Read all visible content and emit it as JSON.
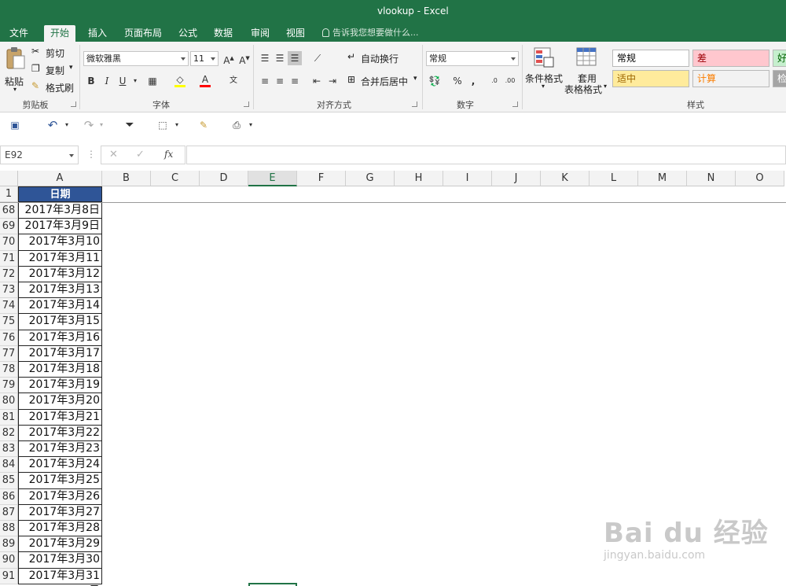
{
  "window": {
    "title": "vlookup - Excel"
  },
  "tabs": [
    "文件",
    "开始",
    "插入",
    "页面布局",
    "公式",
    "数据",
    "审阅",
    "视图"
  ],
  "tell_me": "告诉我您想要做什么...",
  "ribbon": {
    "clipboard": {
      "label": "剪贴板",
      "paste": "粘贴",
      "cut": "剪切",
      "copy": "复制",
      "format_painter": "格式刷"
    },
    "font": {
      "label": "字体",
      "font_name": "微软雅黑",
      "font_size": "11",
      "bold": "B",
      "italic": "I",
      "underline": "U"
    },
    "alignment": {
      "label": "对齐方式",
      "wrap_text": "自动换行",
      "merge_center": "合并后居中"
    },
    "number": {
      "label": "数字",
      "format": "常规",
      "percent": "%",
      "comma": ","
    },
    "styles": {
      "label": "样式",
      "conditional_formatting": "条件格式",
      "format_as_table_1": "套用",
      "format_as_table_2": "表格格式",
      "cells": [
        {
          "text": "常规",
          "bg": "#ffffff",
          "fg": "#000000"
        },
        {
          "text": "差",
          "bg": "#ffc7ce",
          "fg": "#9c0006"
        },
        {
          "text": "好",
          "bg": "#c6efce",
          "fg": "#006100"
        },
        {
          "text": "适中",
          "bg": "#ffeb9c",
          "fg": "#9c6500"
        },
        {
          "text": "计算",
          "bg": "#f2f2f2",
          "fg": "#fa7d00"
        },
        {
          "text": "检",
          "bg": "#a5a5a5",
          "fg": "#ffffff"
        }
      ]
    }
  },
  "formula_bar": {
    "name_box": "E92",
    "fx": "fx",
    "cancel": "✕",
    "enter": "✓",
    "content": ""
  },
  "grid": {
    "columns": [
      "A",
      "B",
      "C",
      "D",
      "E",
      "F",
      "G",
      "H",
      "I",
      "J",
      "K",
      "L",
      "M",
      "N",
      "O"
    ],
    "selected_column": "E",
    "header_row": {
      "row": "1",
      "value": "日期"
    },
    "rows": [
      {
        "row": "68",
        "value": "2017年3月8日"
      },
      {
        "row": "69",
        "value": "2017年3月9日"
      },
      {
        "row": "70",
        "value": "2017年3月10日"
      },
      {
        "row": "71",
        "value": "2017年3月11日"
      },
      {
        "row": "72",
        "value": "2017年3月12日"
      },
      {
        "row": "73",
        "value": "2017年3月13日"
      },
      {
        "row": "74",
        "value": "2017年3月14日"
      },
      {
        "row": "75",
        "value": "2017年3月15日"
      },
      {
        "row": "76",
        "value": "2017年3月16日"
      },
      {
        "row": "77",
        "value": "2017年3月17日"
      },
      {
        "row": "78",
        "value": "2017年3月18日"
      },
      {
        "row": "79",
        "value": "2017年3月19日"
      },
      {
        "row": "80",
        "value": "2017年3月20日"
      },
      {
        "row": "81",
        "value": "2017年3月21日"
      },
      {
        "row": "82",
        "value": "2017年3月22日"
      },
      {
        "row": "83",
        "value": "2017年3月23日"
      },
      {
        "row": "84",
        "value": "2017年3月24日"
      },
      {
        "row": "85",
        "value": "2017年3月25日"
      },
      {
        "row": "86",
        "value": "2017年3月26日"
      },
      {
        "row": "87",
        "value": "2017年3月27日"
      },
      {
        "row": "88",
        "value": "2017年3月28日"
      },
      {
        "row": "89",
        "value": "2017年3月29日"
      },
      {
        "row": "90",
        "value": "2017年3月30日"
      },
      {
        "row": "91",
        "value": "2017年3月31日"
      }
    ]
  },
  "watermark": {
    "brand": "Bai du 经验",
    "url": "jingyan.baidu.com"
  },
  "colors": {
    "accent": "#217346",
    "header_fill": "#2f5597"
  }
}
